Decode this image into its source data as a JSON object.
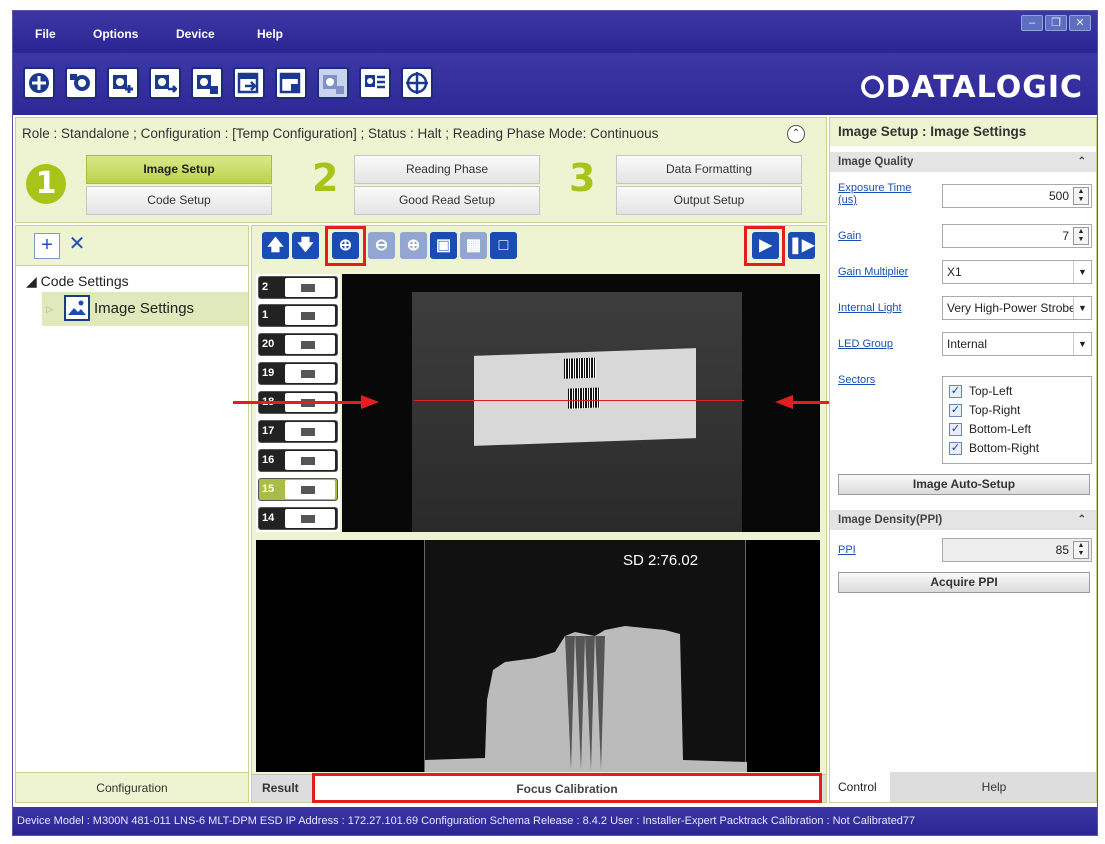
{
  "menu": [
    "File",
    "Options",
    "Device",
    "Help"
  ],
  "window_controls": [
    "minimize-icon",
    "restore-icon",
    "close-icon"
  ],
  "toolbar_icons": [
    "open-icon",
    "camera-icon",
    "add-device-icon",
    "export-device-icon",
    "save-device-icon",
    "upload-icon",
    "download-icon",
    "device-config-icon",
    "settings-list-icon",
    "crosshair-icon"
  ],
  "logo": "⭘DATALOGIC",
  "status_line": "Role :  Standalone ;  Configuration :  [Temp Configuration] ;  Status :  Halt ;  Reading Phase Mode: Continuous",
  "wizard": {
    "step1": "1",
    "step2": "2",
    "step3": "3",
    "image_setup": "Image Setup",
    "code_setup": "Code Setup",
    "reading_phase": "Reading Phase",
    "good_read_setup": "Good Read Setup",
    "data_formatting": "Data Formatting",
    "output_setup": "Output Setup"
  },
  "tree": {
    "root": "Code Settings",
    "child": "Image Settings"
  },
  "left_footer": "Configuration",
  "thumbnails": [
    "2",
    "1",
    "20",
    "19",
    "18",
    "17",
    "16",
    "15",
    "14"
  ],
  "sd_text": "SD 2:76.02",
  "center_tabs": {
    "result": "Result",
    "focus": "Focus Calibration"
  },
  "right": {
    "header": "Image Setup :  Image Settings",
    "image_quality": "Image Quality",
    "exposure_label": "Exposure Time (us)",
    "exposure_value": "500",
    "gain_label": "Gain",
    "gain_value": "7",
    "gain_mult_label": "Gain Multiplier",
    "gain_mult_value": "X1",
    "internal_light_label": "Internal Light",
    "internal_light_value": "Very High-Power Strobe",
    "led_group_label": "LED Group",
    "led_group_value": "Internal",
    "sectors_label": "Sectors",
    "sectors": [
      "Top-Left",
      "Top-Right",
      "Bottom-Left",
      "Bottom-Right"
    ],
    "auto_setup": "Image Auto-Setup",
    "density_section": "Image Density(PPI)",
    "ppi_label": "PPI",
    "ppi_value": "85",
    "acquire_ppi": "Acquire PPI",
    "tab_control": "Control",
    "tab_help": "Help"
  },
  "statusbar": "Device Model : M300N   481-011   LNS-6 MLT-DPM ESD   IP Address :  172.27.101.69   Configuration Schema Release :  8.4.2   User : Installer-Expert   Packtrack Calibration : Not Calibrated77",
  "colors": {
    "title_bar": "#2d2896",
    "accent_green": "#a8c41a",
    "highlight_red": "#e41e1e",
    "link_blue": "#1a4fb3"
  }
}
